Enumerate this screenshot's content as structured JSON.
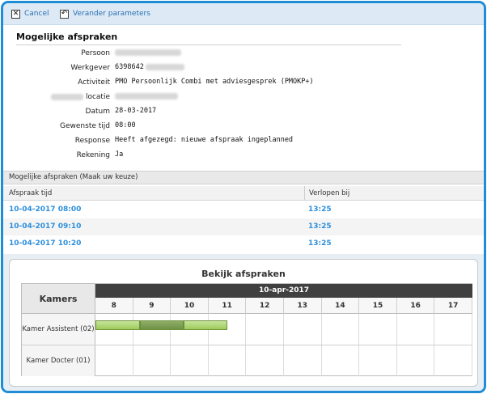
{
  "toolbar": {
    "cancel_label": "Cancel",
    "change_params_label": "Verander parameters"
  },
  "details": {
    "title": "Mogelijke afspraken",
    "rows": [
      {
        "label": "Persoon",
        "value": ""
      },
      {
        "label": "Werkgever",
        "value": "6398642"
      },
      {
        "label": "Activiteit",
        "value": "PMO Persoonlijk Combi met adviesgesprek (PMOKP+)"
      },
      {
        "label": "locatie",
        "value": ""
      },
      {
        "label": "Datum",
        "value": "28-03-2017"
      },
      {
        "label": "Gewenste tijd",
        "value": "08:00"
      },
      {
        "label": "Response",
        "value": "Heeft afgezegd: nieuwe afspraak ingeplanned"
      },
      {
        "label": "Rekening",
        "value": "Ja"
      }
    ]
  },
  "appointments": {
    "header": "Mogelijke afspraken (Maak uw keuze)",
    "columns": [
      "Afspraak tijd",
      "Verlopen bij"
    ],
    "rows": [
      {
        "time": "10-04-2017 08:00",
        "expires": "13:25"
      },
      {
        "time": "10-04-2017 09:10",
        "expires": "13:25"
      },
      {
        "time": "10-04-2017 10:20",
        "expires": "13:25"
      }
    ]
  },
  "schedule": {
    "title": "Bekijk afspraken",
    "corner_label": "Kamers",
    "date": "10-apr-2017",
    "hours": [
      "8",
      "9",
      "10",
      "11",
      "12",
      "13",
      "14",
      "15",
      "16",
      "17"
    ],
    "rooms": [
      "Kamer Assistent (02)",
      "Kamer Docter (01)"
    ],
    "bookings": [
      {
        "room": 0,
        "start": 8.0,
        "end": 9.17,
        "style": "light"
      },
      {
        "room": 0,
        "start": 9.17,
        "end": 10.33,
        "style": "dark"
      },
      {
        "room": 0,
        "start": 10.33,
        "end": 11.5,
        "style": "light"
      }
    ]
  },
  "colors": {
    "frame": "#1f8dd6",
    "link": "#2d8fdd",
    "date_bar": "#404040",
    "booking": "#9ccb5a"
  }
}
